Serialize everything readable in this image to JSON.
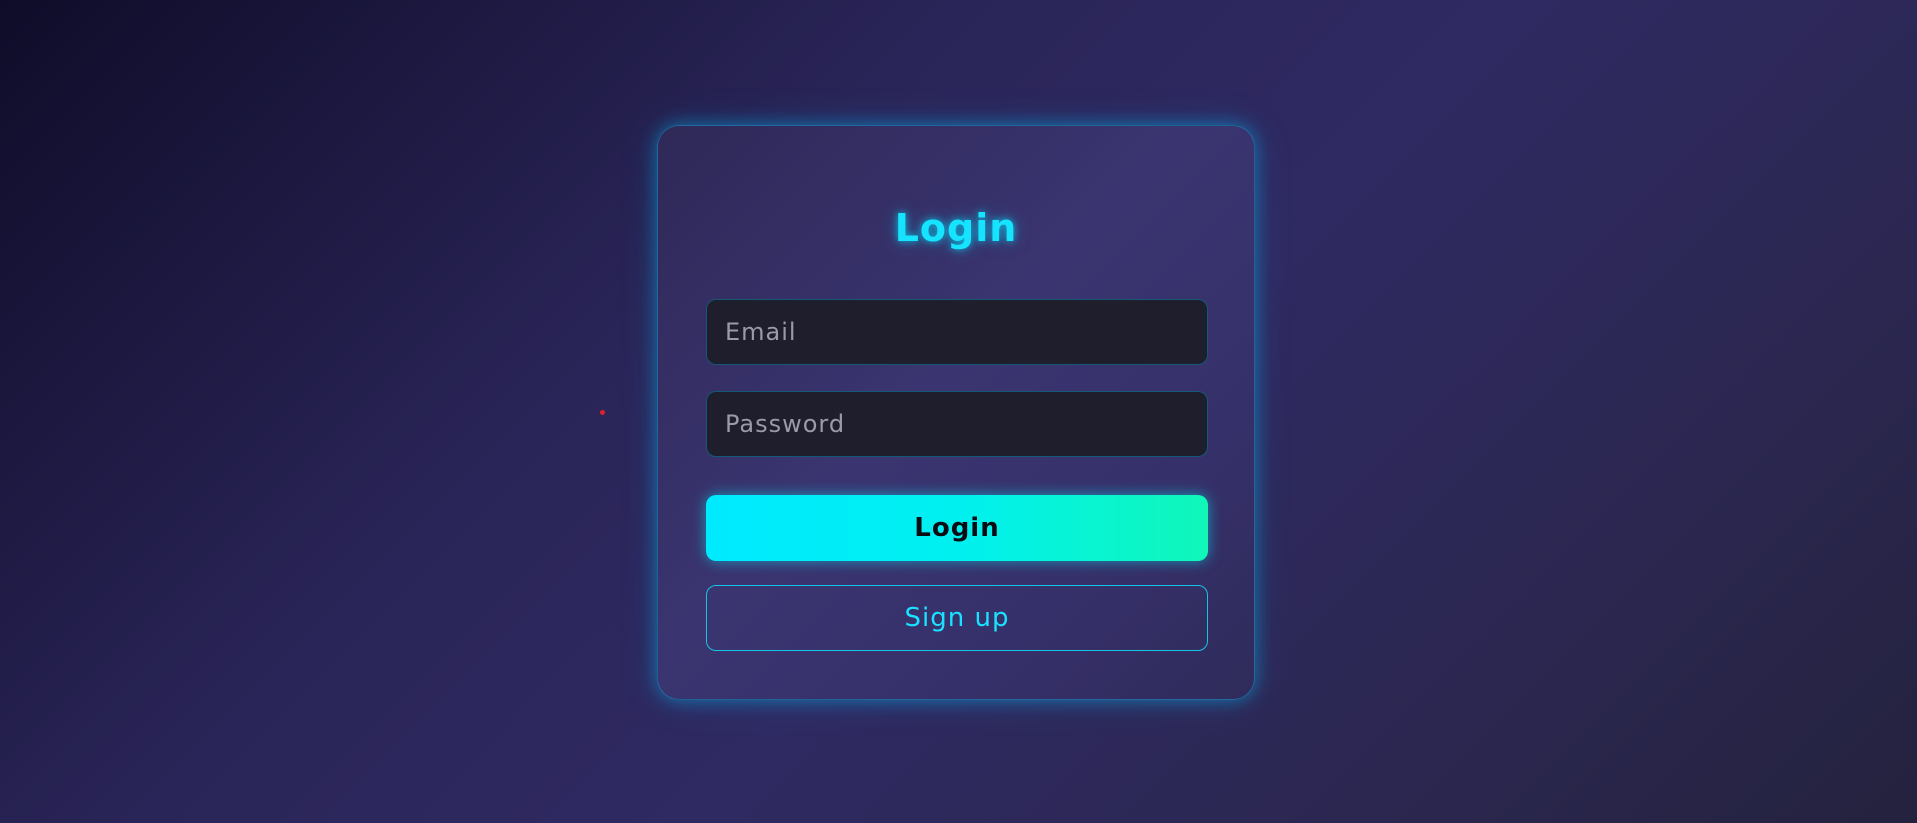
{
  "login_card": {
    "title": "Login",
    "email": {
      "placeholder": "Email",
      "value": ""
    },
    "password": {
      "placeholder": "Password",
      "value": ""
    },
    "login_button_label": "Login",
    "signup_button_label": "Sign up"
  },
  "colors": {
    "accent": "#16e4ff",
    "button_gradient_start": "#00eaff",
    "button_gradient_end": "#10f7b8",
    "input_background": "#1e1e2c",
    "cursor_marker": "#e0202e"
  }
}
